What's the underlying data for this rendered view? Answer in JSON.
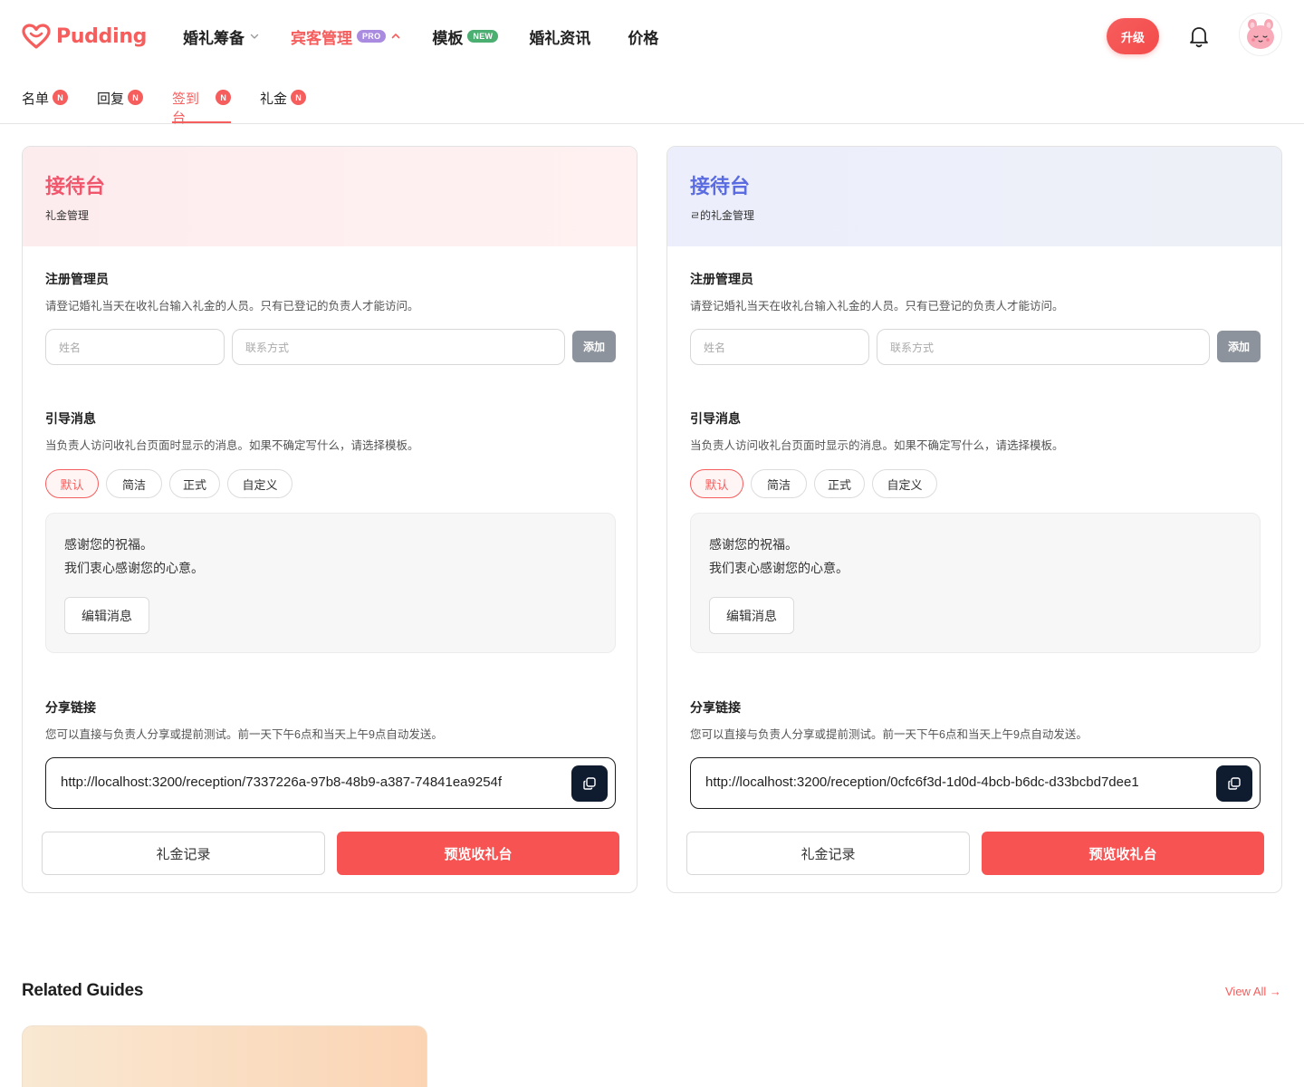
{
  "brand": {
    "name": "Pudding",
    "accent": "#f65d5d"
  },
  "nav": {
    "items": [
      {
        "label": "婚礼筹备"
      },
      {
        "label": "宾客管理",
        "badge": "PRO"
      },
      {
        "label": "模板",
        "badge": "NEW"
      },
      {
        "label": "婚礼资讯"
      },
      {
        "label": "价格"
      }
    ]
  },
  "header": {
    "upgrade_label": "升级",
    "bell_icon": "bell-icon",
    "avatar_icon": "bunny-avatar"
  },
  "subtabs": [
    {
      "label": "名单",
      "badge": "N"
    },
    {
      "label": "回复",
      "badge": "N"
    },
    {
      "label": "签到台",
      "badge": "N",
      "active": true
    },
    {
      "label": "礼金",
      "badge": "N"
    }
  ],
  "cards": [
    {
      "title": "接待台",
      "subtitle": "礼金管理",
      "register": {
        "title": "注册管理员",
        "desc": "请登记婚礼当天在收礼台输入礼金的人员。只有已登记的负责人才能访问。",
        "name_placeholder": "姓名",
        "contact_placeholder": "联系方式",
        "add_label": "添加"
      },
      "guide": {
        "title": "引导消息",
        "desc": "当负责人访问收礼台页面时显示的消息。如果不确定写什么，请选择模板。",
        "options": [
          "默认",
          "简洁",
          "正式",
          "自定义"
        ],
        "selected": "默认",
        "message_line1": "感谢您的祝福。",
        "message_line2": "我们衷心感谢您的心意。",
        "edit_label": "编辑消息"
      },
      "share": {
        "title": "分享链接",
        "desc": "您可以直接与负责人分享或提前测试。前一天下午6点和当天上午9点自动发送。",
        "url": "http://localhost:3200/reception/7337226a-97b8-48b9-a387-74841ea9254f"
      },
      "records_label": "礼金记录",
      "preview_label": "预览收礼台"
    },
    {
      "title": "接待台",
      "subtitle": "ㄹ的礼金管理",
      "register": {
        "title": "注册管理员",
        "desc": "请登记婚礼当天在收礼台输入礼金的人员。只有已登记的负责人才能访问。",
        "name_placeholder": "姓名",
        "contact_placeholder": "联系方式",
        "add_label": "添加"
      },
      "guide": {
        "title": "引导消息",
        "desc": "当负责人访问收礼台页面时显示的消息。如果不确定写什么，请选择模板。",
        "options": [
          "默认",
          "简洁",
          "正式",
          "自定义"
        ],
        "selected": "默认",
        "message_line1": "感谢您的祝福。",
        "message_line2": "我们衷心感谢您的心意。",
        "edit_label": "编辑消息"
      },
      "share": {
        "title": "分享链接",
        "desc": "您可以直接与负责人分享或提前测试。前一天下午6点和当天上午9点自动发送。",
        "url": "http://localhost:3200/reception/0cfc6f3d-1d0d-4bcb-b6dc-d33bcbd7dee1"
      },
      "records_label": "礼金记录",
      "preview_label": "预览收礼台"
    }
  ],
  "related": {
    "title": "Related Guides",
    "view_all": "View All →"
  }
}
